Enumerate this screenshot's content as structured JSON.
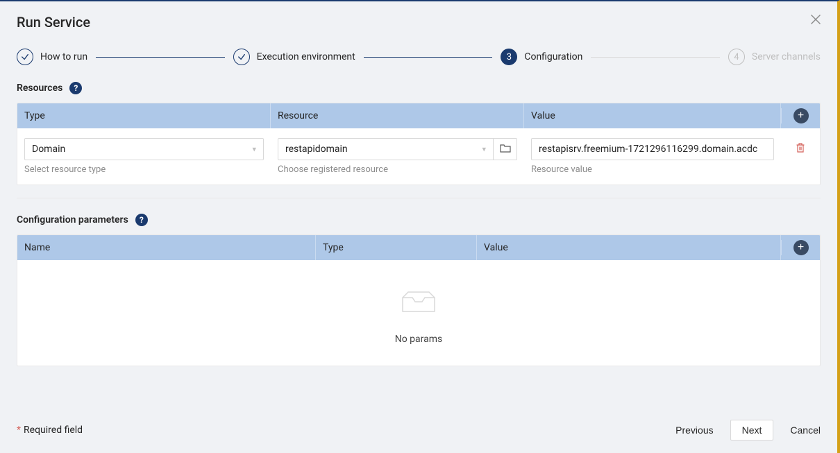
{
  "modal": {
    "title": "Run Service"
  },
  "steps": {
    "s1": {
      "label": "How to run"
    },
    "s2": {
      "label": "Execution environment"
    },
    "s3": {
      "num": "3",
      "label": "Configuration"
    },
    "s4": {
      "num": "4",
      "label": "Server channels"
    }
  },
  "resources": {
    "title": "Resources",
    "columns": {
      "type": "Type",
      "resource": "Resource",
      "value": "Value"
    },
    "row": {
      "type_value": "Domain",
      "type_hint": "Select resource type",
      "resource_value": "restapidomain",
      "resource_hint": "Choose registered resource",
      "value_value": "restapisrv.freemium-1721296116299.domain.acdc",
      "value_hint": "Resource value"
    }
  },
  "params": {
    "title": "Configuration parameters",
    "columns": {
      "name": "Name",
      "type": "Type",
      "value": "Value"
    },
    "empty_text": "No params"
  },
  "footer": {
    "required_label": "Required field",
    "previous": "Previous",
    "next": "Next",
    "cancel": "Cancel"
  }
}
